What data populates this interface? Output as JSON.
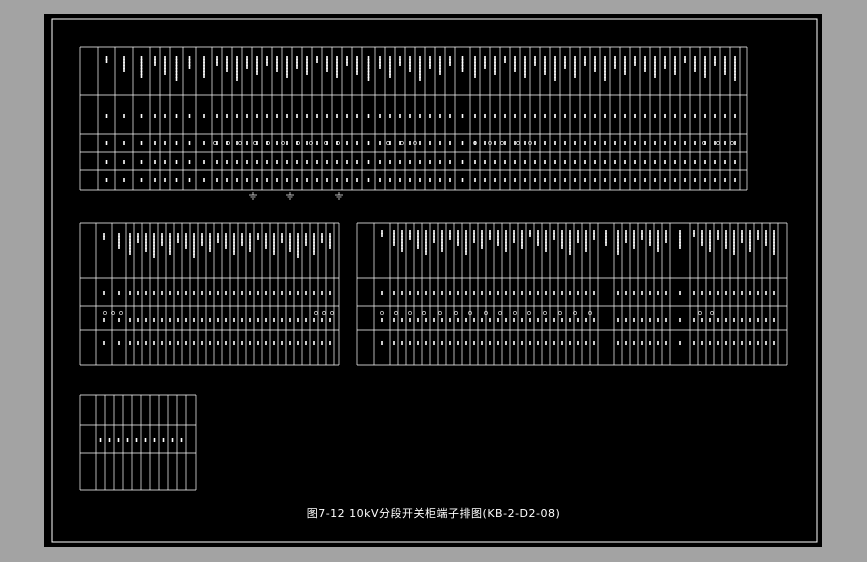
{
  "drawing": {
    "caption": "图7-12 10kV分段开关柜端子排图(KB-2-D2-08)",
    "colors": {
      "background": "#a3a3a3",
      "sheet": "#000000",
      "line": "#ffffff"
    }
  }
}
